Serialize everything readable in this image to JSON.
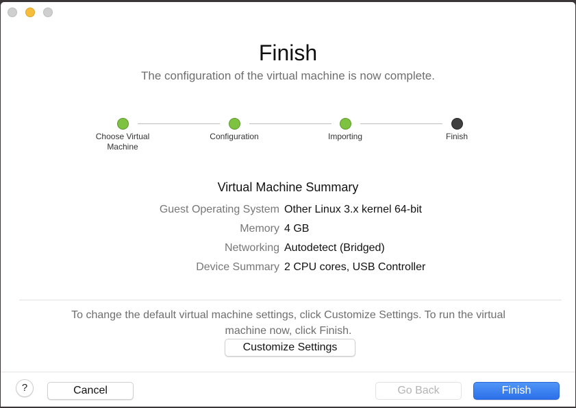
{
  "window": {
    "controls": [
      "close",
      "minimize",
      "zoom"
    ]
  },
  "header": {
    "title": "Finish",
    "subtitle": "The configuration of the virtual machine is now complete."
  },
  "steps": [
    {
      "label": "Choose Virtual Machine",
      "status": "done"
    },
    {
      "label": "Configuration",
      "status": "done"
    },
    {
      "label": "Importing",
      "status": "done"
    },
    {
      "label": "Finish",
      "status": "current"
    }
  ],
  "colors": {
    "step_done": "#7ec241",
    "step_current": "#3f3f3f",
    "primary_button": "#2c6fe9",
    "minimize_light": "#f6bd3b"
  },
  "summary": {
    "title": "Virtual Machine Summary",
    "rows": [
      {
        "key": "Guest Operating System",
        "value": "Other Linux 3.x kernel 64-bit"
      },
      {
        "key": "Memory",
        "value": "4 GB"
      },
      {
        "key": "Networking",
        "value": "Autodetect (Bridged)"
      },
      {
        "key": "Device Summary",
        "value": "2 CPU cores, USB Controller"
      }
    ]
  },
  "note": "To change the default virtual machine settings, click Customize Settings. To run the virtual machine now, click Finish.",
  "buttons": {
    "customize": "Customize Settings",
    "help": "?",
    "cancel": "Cancel",
    "go_back": "Go Back",
    "finish": "Finish"
  }
}
